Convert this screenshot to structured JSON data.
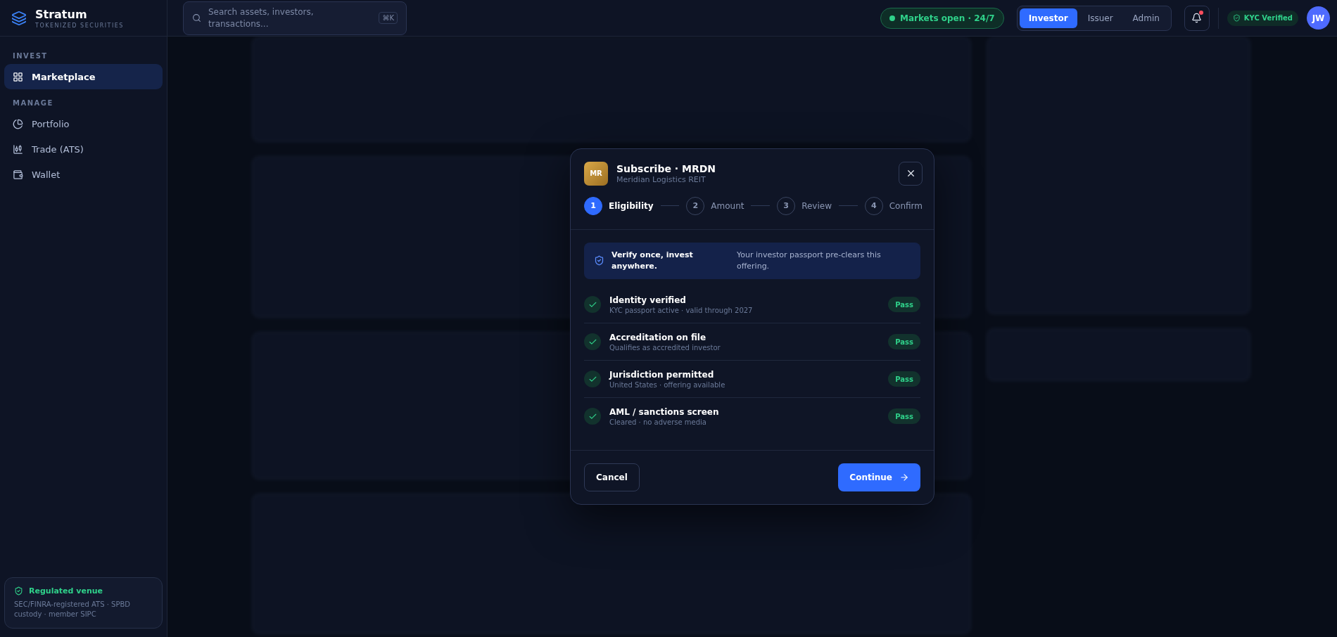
{
  "brand": {
    "name": "Stratum",
    "tagline": "TOKENIZED SECURITIES"
  },
  "search": {
    "placeholder": "Search assets, investors, transactions...",
    "shortcut": "⌘K"
  },
  "market_status": {
    "label": "Markets open · 24/7",
    "open": true
  },
  "roles": [
    {
      "label": "Investor",
      "selected": true
    },
    {
      "label": "Issuer",
      "selected": false
    },
    {
      "label": "Admin",
      "selected": false
    }
  ],
  "notifications": {
    "unread": true
  },
  "kyc_badge": "KYC Verified",
  "avatar": "JW",
  "sidebar": {
    "sections": [
      {
        "title": "INVEST",
        "items": [
          {
            "label": "Marketplace",
            "selected": true
          }
        ]
      },
      {
        "title": "MANAGE",
        "items": [
          {
            "label": "Portfolio",
            "selected": false
          },
          {
            "label": "Trade (ATS)",
            "selected": false
          },
          {
            "label": "Wallet",
            "selected": false
          }
        ]
      }
    ],
    "notice": {
      "title": "Regulated venue",
      "text": "SEC/FINRA-registered ATS · SPBD custody · member SIPC"
    }
  },
  "modal": {
    "logo": "MR",
    "title": "Subscribe · MRDN",
    "subtitle": "Meridian Logistics REIT",
    "steps": [
      {
        "number": "1",
        "label": "Eligibility",
        "selected": true
      },
      {
        "number": "2",
        "label": "Amount",
        "selected": false
      },
      {
        "number": "3",
        "label": "Review",
        "selected": false
      },
      {
        "number": "4",
        "label": "Confirm",
        "selected": false
      }
    ],
    "banner": {
      "title": "Verify once, invest anywhere.",
      "text": "Your investor passport pre-clears this offering."
    },
    "checks": [
      {
        "title": "Identity verified",
        "detail": "KYC passport active · valid through 2027",
        "status": "Pass",
        "passed": true
      },
      {
        "title": "Accreditation on file",
        "detail": "Qualifies as accredited investor",
        "status": "Pass",
        "passed": true
      },
      {
        "title": "Jurisdiction permitted",
        "detail": "United States · offering available",
        "status": "Pass",
        "passed": true
      },
      {
        "title": "AML / sanctions screen",
        "detail": "Cleared · no adverse media",
        "status": "Pass",
        "passed": true
      }
    ],
    "cancel": "Cancel",
    "continue": "Continue"
  }
}
